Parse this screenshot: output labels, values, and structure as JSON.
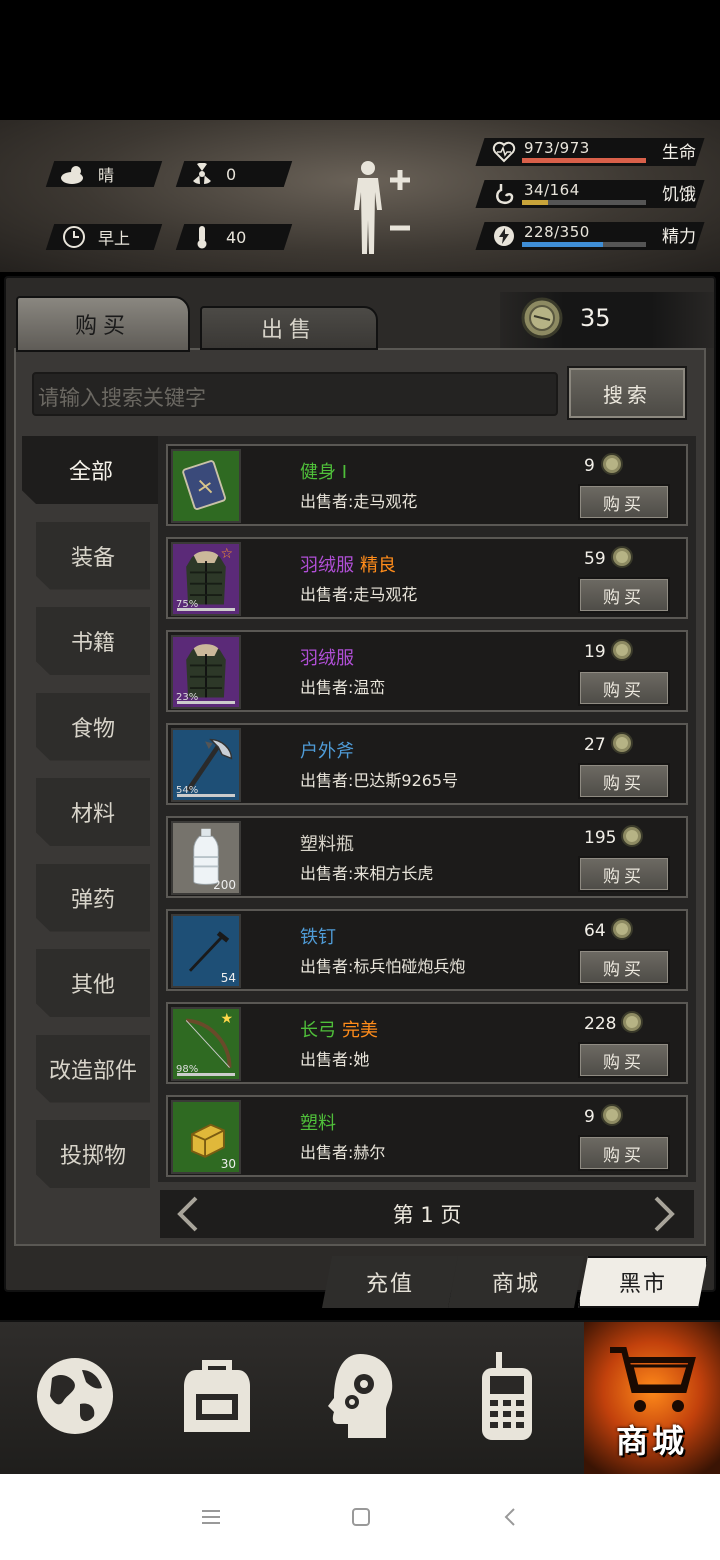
{
  "hud": {
    "weather": "晴",
    "radiation": "0",
    "time_of_day": "早上",
    "temperature": "40",
    "health": {
      "text": "973/973",
      "label": "生命",
      "fraction": 1.0,
      "color": "#d9604a"
    },
    "hunger": {
      "text": "34/164",
      "label": "饥饿",
      "fraction": 0.21,
      "color": "#c9a43a"
    },
    "energy": {
      "text": "228/350",
      "label": "精力",
      "fraction": 0.65,
      "color": "#3f8ed6"
    }
  },
  "tabs": {
    "buy": "购买",
    "sell": "出售"
  },
  "coins": "35",
  "search": {
    "placeholder": "请输入搜索关键字",
    "button": "搜索"
  },
  "categories": [
    "全部",
    "装备",
    "书籍",
    "食物",
    "材料",
    "弹药",
    "其他",
    "改造部件",
    "投掷物"
  ],
  "items": [
    {
      "name": "健身 I",
      "quality": "",
      "name_color": "#4fbf3a",
      "quality_color": "",
      "seller": "出售者:走马观花",
      "price": "9",
      "icon": "book-icon",
      "bg": "#2f6a22",
      "badge": "",
      "star": "",
      "buy": "购买"
    },
    {
      "name": "羽绒服",
      "quality": "精良",
      "name_color": "#b04fd6",
      "quality_color": "#ff8c1a",
      "seller": "出售者:走马观花",
      "price": "59",
      "icon": "down-jacket-icon",
      "bg": "#5b2a78",
      "badge": "75%",
      "star": "☆",
      "buy": "购买"
    },
    {
      "name": "羽绒服",
      "quality": "",
      "name_color": "#b04fd6",
      "quality_color": "",
      "seller": "出售者:温峦",
      "price": "19",
      "icon": "down-jacket-icon",
      "bg": "#5b2a78",
      "badge": "23%",
      "star": "",
      "buy": "购买"
    },
    {
      "name": "户外斧",
      "quality": "",
      "name_color": "#4f9bd6",
      "quality_color": "",
      "seller": "出售者:巴达斯9265号",
      "price": "27",
      "icon": "axe-icon",
      "bg": "#1e4f76",
      "badge": "54%",
      "star": "",
      "buy": "购买"
    },
    {
      "name": "塑料瓶",
      "quality": "",
      "name_color": "#d8d4ca",
      "quality_color": "",
      "seller": "出售者:来相方长虎",
      "price": "195",
      "icon": "bottle-icon",
      "bg": "#76736c",
      "badge": "200",
      "star": "",
      "buy": "购买"
    },
    {
      "name": "铁钉",
      "quality": "",
      "name_color": "#4f9bd6",
      "quality_color": "",
      "seller": "出售者:标兵怕碰炮兵炮",
      "price": "64",
      "icon": "nail-icon",
      "bg": "#1e4f76",
      "badge": "54",
      "star": "",
      "buy": "购买"
    },
    {
      "name": "长弓",
      "quality": "完美",
      "name_color": "#4fbf3a",
      "quality_color": "#ff8c1a",
      "seller": "出售者:她",
      "price": "228",
      "icon": "longbow-icon",
      "bg": "#2f6a22",
      "badge": "98%",
      "star": "★",
      "buy": "购买"
    },
    {
      "name": "塑料",
      "quality": "",
      "name_color": "#4fbf3a",
      "quality_color": "",
      "seller": "出售者:赫尔",
      "price": "9",
      "icon": "plastic-icon",
      "bg": "#2f6a22",
      "badge": "30",
      "star": "",
      "buy": "购买"
    }
  ],
  "pager": {
    "label": "第 1 页"
  },
  "bottom_tabs": {
    "recharge": "充值",
    "mall": "商城",
    "black_market": "黑市"
  },
  "nav": {
    "shop_label": "商城"
  }
}
